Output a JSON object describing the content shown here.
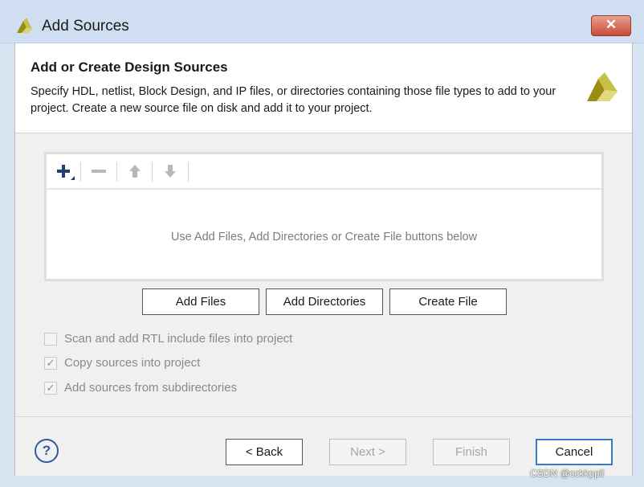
{
  "window": {
    "title": "Add Sources",
    "close_glyph": "✕"
  },
  "header": {
    "title": "Add or Create Design Sources",
    "description": "Specify HDL, netlist, Block Design, and IP files, or directories containing those file types to add to your project. Create a new source file on disk and add it to your project."
  },
  "file_panel": {
    "toolbar": {
      "add_icon": "plus-icon",
      "remove_icon": "minus-icon",
      "up_icon": "arrow-up-icon",
      "down_icon": "arrow-down-icon"
    },
    "empty_message": "Use Add Files, Add Directories or Create File buttons below"
  },
  "action_buttons": {
    "add_files": "Add Files",
    "add_directories": "Add Directories",
    "create_file": "Create File"
  },
  "options": [
    {
      "label": "Scan and add RTL include files into project",
      "checked": false
    },
    {
      "label": "Copy sources into project",
      "checked": true
    },
    {
      "label": "Add sources from subdirectories",
      "checked": true
    }
  ],
  "footer": {
    "help_glyph": "?",
    "back": "< Back",
    "next": "Next >",
    "finish": "Finish",
    "cancel": "Cancel"
  },
  "watermark": "CSDN @cckkppll",
  "colors": {
    "logo_dark": "#9a8c14",
    "logo_light": "#c8c044",
    "help_blue": "#2f5c9c",
    "close_red": "#c74b36"
  }
}
